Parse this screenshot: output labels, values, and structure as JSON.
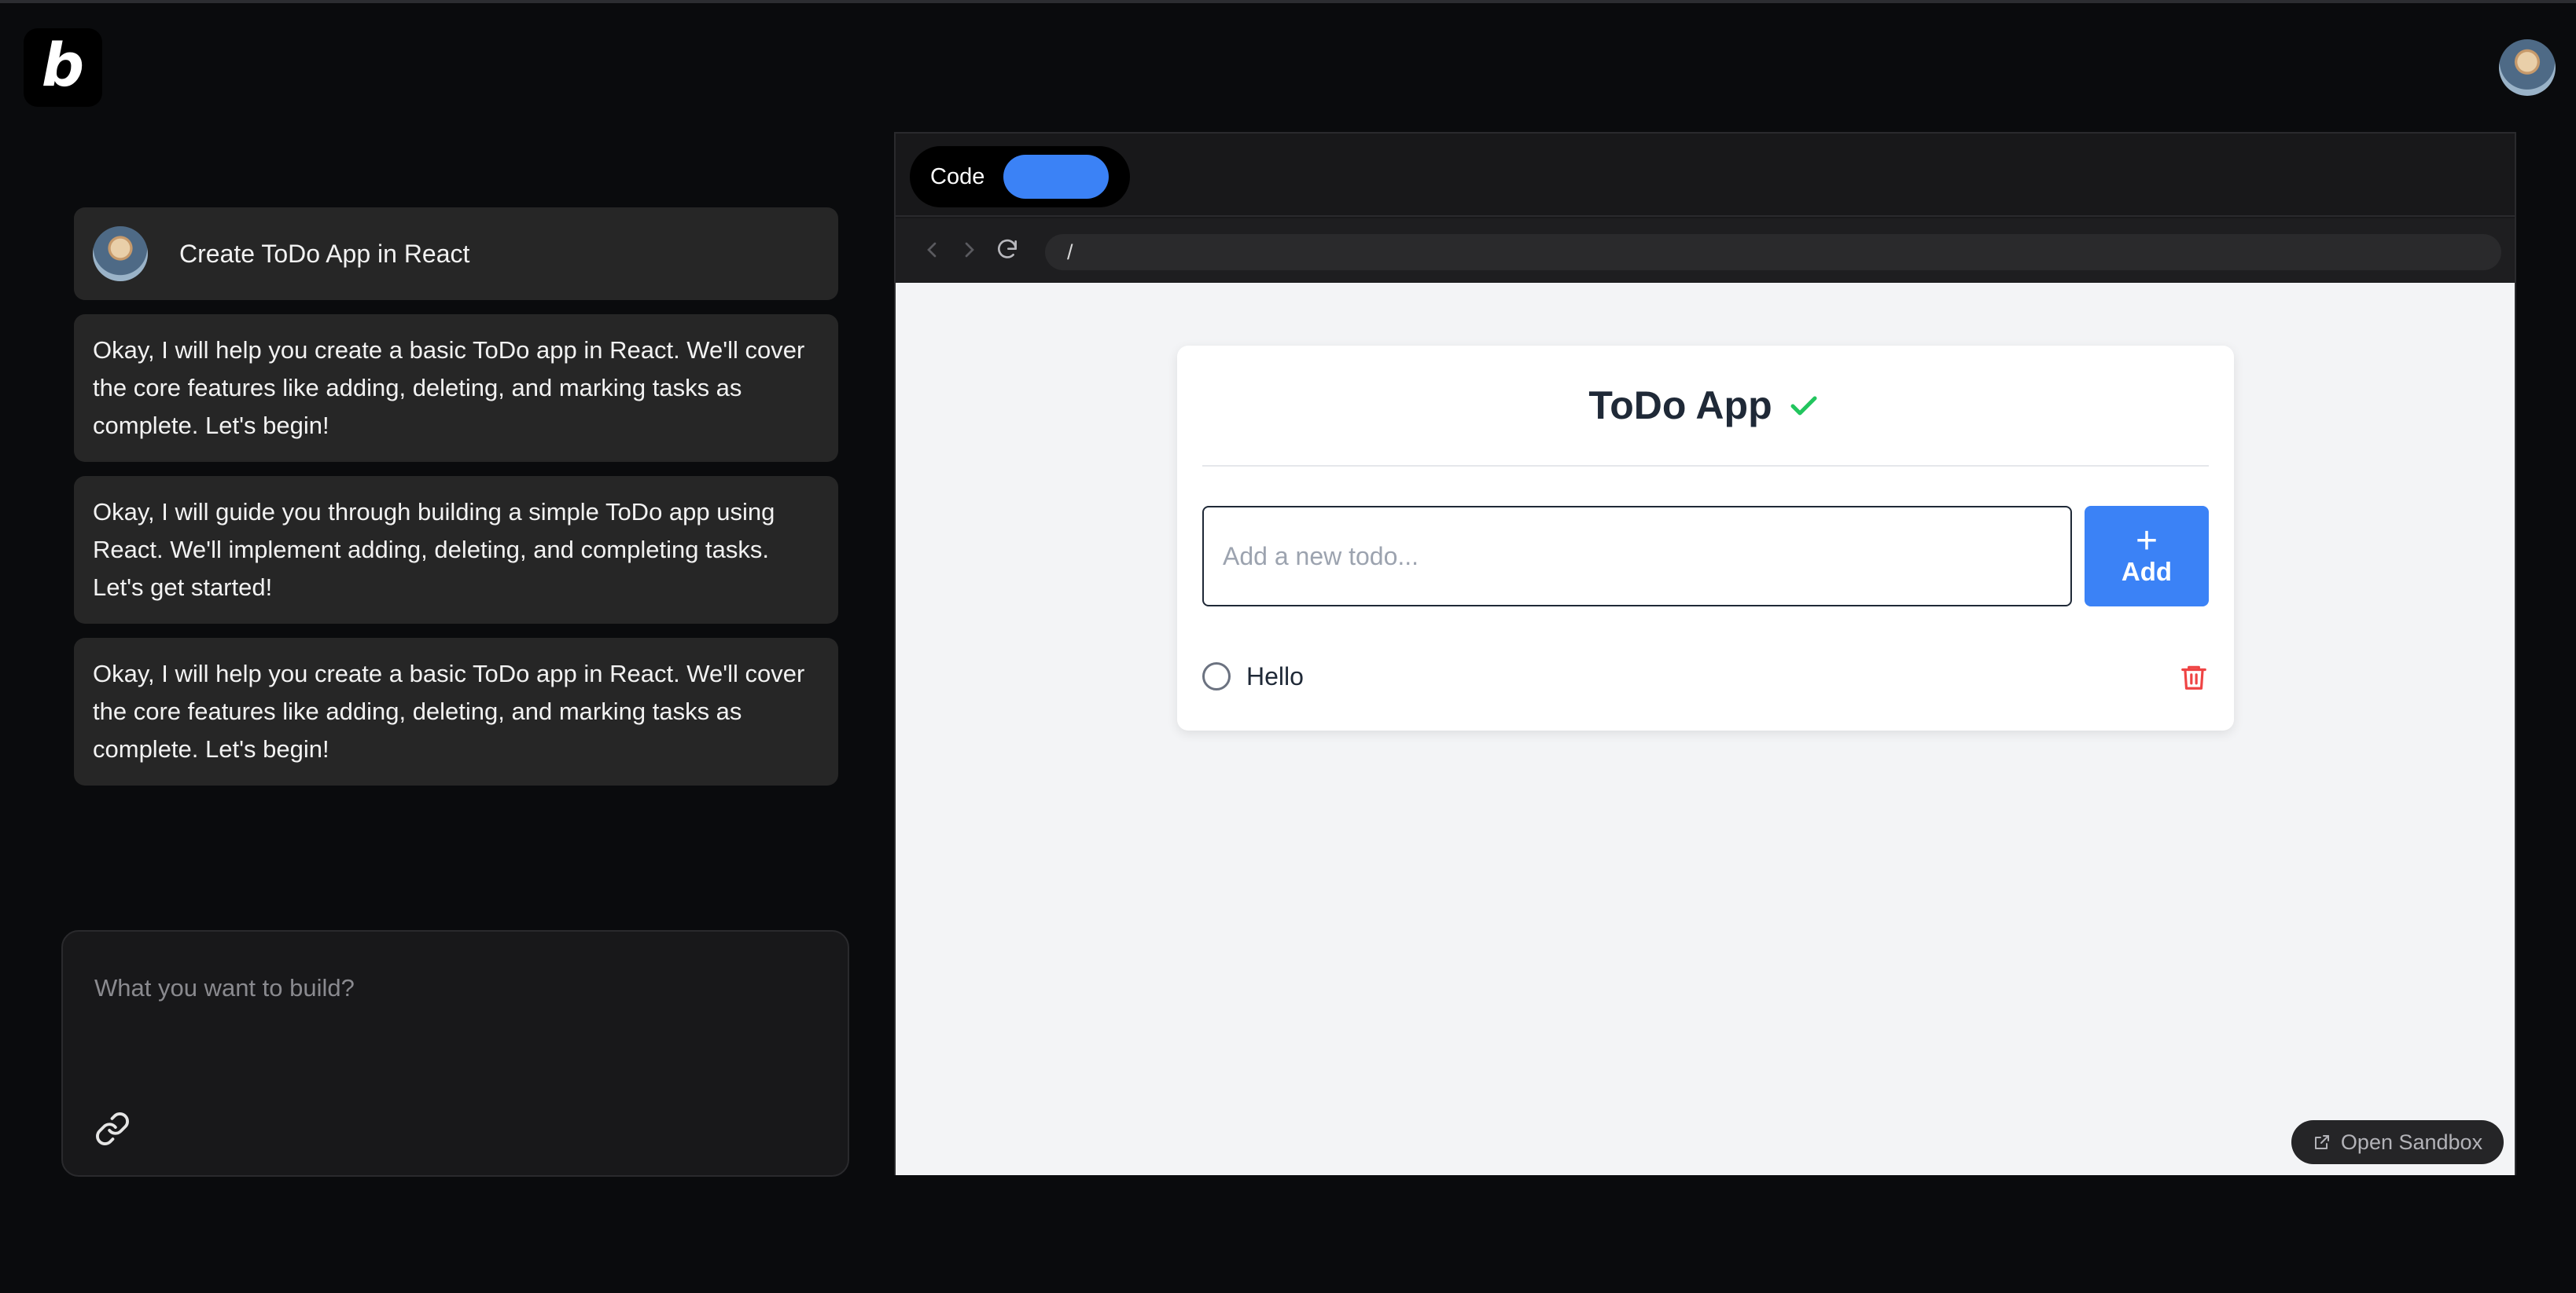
{
  "header": {
    "logo_letter": "b"
  },
  "chat": {
    "user_prompt": "Create ToDo App in React",
    "responses": [
      "Okay, I will help you create a basic ToDo app in React. We'll cover the core features like adding, deleting, and marking tasks as complete. Let's begin!",
      "Okay, I will guide you through building a simple ToDo app using React. We'll implement adding, deleting, and completing tasks. Let's get started!",
      "Okay, I will help you create a basic ToDo app in React. We'll cover the core features like adding, deleting, and marking tasks as complete. Let's begin!"
    ],
    "input_placeholder": "What you want to build?"
  },
  "panel": {
    "toggle_label": "Code",
    "url": "/",
    "open_sandbox_label": "Open Sandbox"
  },
  "todo_app": {
    "title": "ToDo App",
    "input_placeholder": "Add a new todo...",
    "add_label": "Add",
    "add_icon": "+",
    "items": [
      {
        "text": "Hello",
        "completed": false
      }
    ]
  },
  "icons": {
    "logo": "b-logo-icon",
    "link": "link-icon",
    "back": "chevron-left-icon",
    "forward": "chevron-right-icon",
    "reload": "reload-icon",
    "check": "check-icon",
    "trash": "trash-icon",
    "external": "external-link-icon"
  },
  "colors": {
    "background": "#0a0b0d",
    "card": "#262626",
    "accent": "#3b82f6",
    "check_green": "#22c55e",
    "trash_red": "#ef4444"
  }
}
